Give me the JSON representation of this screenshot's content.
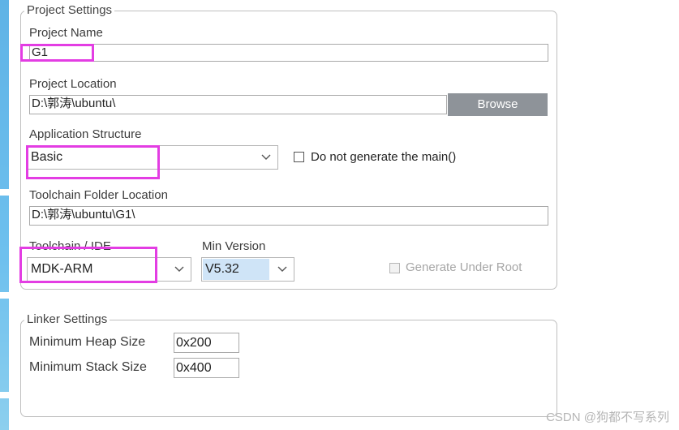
{
  "project_settings": {
    "legend": "Project Settings",
    "project_name": {
      "label": "Project Name",
      "value": "G1"
    },
    "project_location": {
      "label": "Project Location",
      "value": "D:\\郭涛\\ubuntu\\",
      "browse_label": "Browse"
    },
    "application_structure": {
      "label": "Application Structure",
      "value": "Basic",
      "checkbox_label": "Do not generate the main()"
    },
    "toolchain_folder": {
      "label": "Toolchain Folder Location",
      "value": "D:\\郭涛\\ubuntu\\G1\\"
    },
    "toolchain_ide": {
      "label": "Toolchain / IDE",
      "value": "MDK-ARM"
    },
    "min_version": {
      "label": "Min Version",
      "value": "V5.32"
    },
    "generate_under_root": {
      "label": "Generate Under Root",
      "checked": false,
      "enabled": false
    }
  },
  "linker_settings": {
    "legend": "Linker Settings",
    "min_heap": {
      "label": "Minimum Heap Size",
      "value": "0x200"
    },
    "min_stack": {
      "label": "Minimum Stack Size",
      "value": "0x400"
    }
  },
  "watermark": "CSDN @狗都不写系列",
  "colors": {
    "highlight": "#e33de3",
    "browse_button": "#8e9399",
    "selection": "#cfe4f7"
  }
}
